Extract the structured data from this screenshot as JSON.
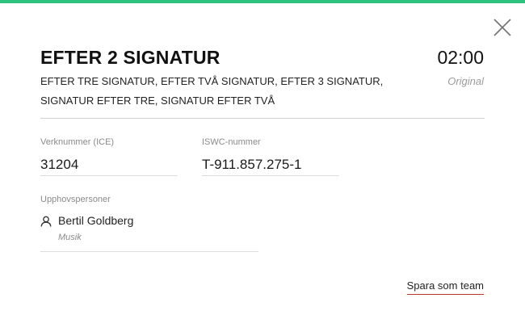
{
  "colors": {
    "accent_bar": "#2ec27e",
    "link_underline": "#c0392b"
  },
  "work": {
    "title": "EFTER 2 SIGNATUR",
    "duration": "02:00",
    "version": "Original",
    "alternative_titles": "EFTER TRE SIGNATUR, EFTER TVÅ SIGNATUR, EFTER 3 SIGNATUR, SIGNATUR EFTER TRE, SIGNATUR EFTER TVÅ"
  },
  "fields": {
    "ice_label": "Verknummer (ICE)",
    "ice_value": "31204",
    "iswc_label": "ISWC-nummer",
    "iswc_value": "T-911.857.275-1"
  },
  "creators": {
    "label": "Upphovspersoner",
    "items": [
      {
        "name": "Bertil Goldberg",
        "role": "Musik",
        "icon": "person-icon"
      }
    ]
  },
  "actions": {
    "save_team": "Spara som team",
    "close_icon": "close-icon"
  }
}
